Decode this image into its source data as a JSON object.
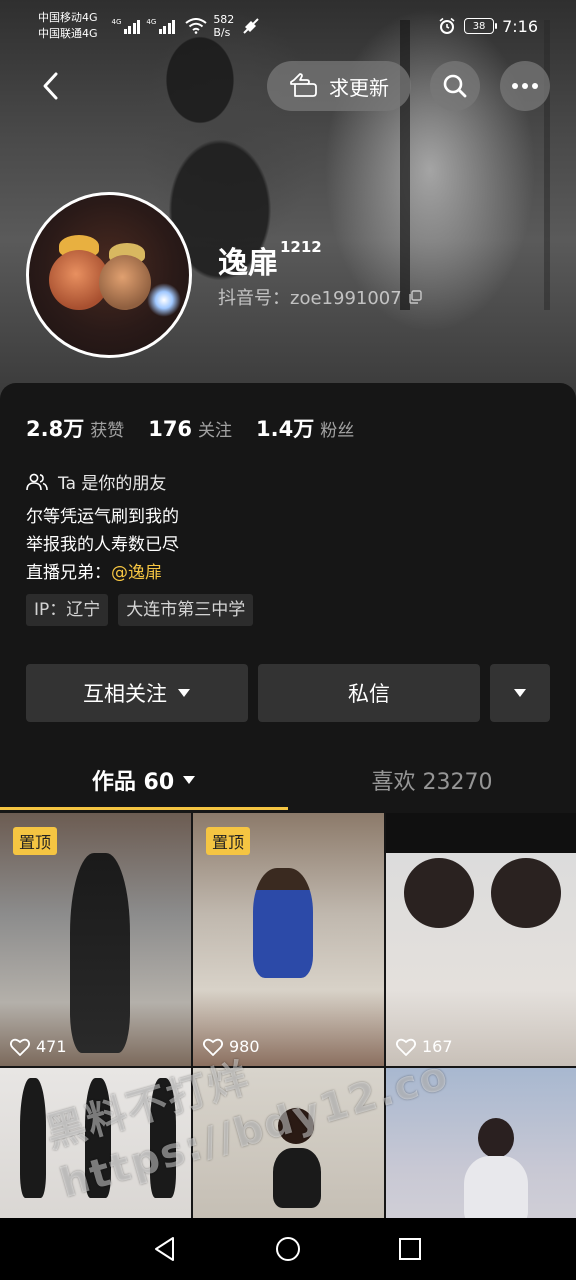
{
  "status_bar": {
    "carrier_1": "中国移动4G",
    "carrier_2": "中国联通4G",
    "net_label_1": "4G",
    "net_label_2": "4G",
    "net_label_3": "6",
    "speed_value": "582",
    "speed_unit": "B/s",
    "battery": "38",
    "time": "7:16"
  },
  "nav": {
    "request_update_label": "求更新"
  },
  "profile": {
    "nickname": "逸扉",
    "nickname_sup": "1212",
    "douyin_id": "抖音号：zoe1991007"
  },
  "stats": [
    {
      "value": "2.8万",
      "label": "获赞"
    },
    {
      "value": "176",
      "label": "关注"
    },
    {
      "value": "1.4万",
      "label": "粉丝"
    }
  ],
  "friend_text": "Ta 是你的朋友",
  "bio": {
    "line1": "尔等凭运气刷到我的",
    "line2": "举报我的人寿数已尽",
    "line3_prefix": "直播兄弟：",
    "line3_mention": "@逸扉"
  },
  "tags": [
    "IP：辽宁",
    "大连市第三中学"
  ],
  "actions": {
    "follow_label": "互相关注",
    "message_label": "私信"
  },
  "tabs": {
    "works_label": "作品 60",
    "likes_label": "喜欢 23270"
  },
  "grid": [
    {
      "pinned": true,
      "pin_label": "置顶",
      "likes": "471"
    },
    {
      "pinned": true,
      "pin_label": "置顶",
      "likes": "980"
    },
    {
      "pinned": false,
      "pin_label": "",
      "likes": "167"
    },
    {
      "pinned": false,
      "pin_label": "",
      "likes": ""
    },
    {
      "pinned": false,
      "pin_label": "",
      "likes": ""
    },
    {
      "pinned": false,
      "pin_label": "",
      "likes": ""
    }
  ],
  "watermark": {
    "line1": "黑料不打烊",
    "line2": "https://bdy12.co"
  },
  "colors": {
    "accent": "#f5c542",
    "background": "#161616",
    "button": "#333333"
  }
}
